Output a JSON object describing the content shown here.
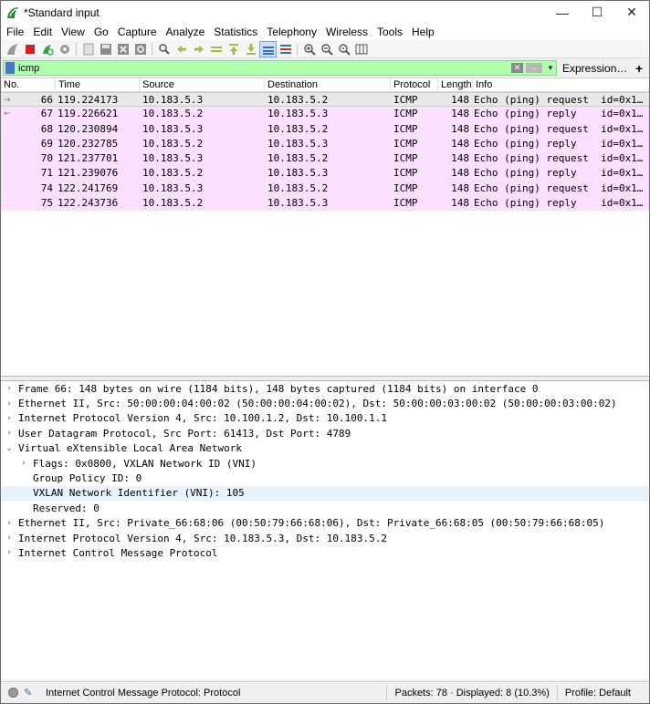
{
  "window": {
    "title": "*Standard input",
    "minimize_glyph": "—",
    "maximize_glyph": "☐",
    "close_glyph": "✕"
  },
  "menu": [
    "File",
    "Edit",
    "View",
    "Go",
    "Capture",
    "Analyze",
    "Statistics",
    "Telephony",
    "Wireless",
    "Tools",
    "Help"
  ],
  "toolbar_icons": [
    "shark-fin-icon",
    "stop-icon",
    "restart-icon",
    "capture-options-icon",
    "open-file-icon",
    "save-file-icon",
    "close-file-icon",
    "reload-icon",
    "find-packet-icon",
    "go-back-icon",
    "go-forward-icon",
    "go-to-packet-icon",
    "go-first-icon",
    "go-last-icon",
    "autoscroll-icon",
    "colorize-icon",
    "zoom-in-icon",
    "zoom-out-icon",
    "zoom-normal-icon",
    "resize-columns-icon"
  ],
  "filter": {
    "value": "icmp",
    "expression_label": "Expression…",
    "add_label": "+"
  },
  "packet_list": {
    "columns": [
      "No.",
      "Time",
      "Source",
      "Destination",
      "Protocol",
      "Length",
      "Info"
    ],
    "rows": [
      {
        "no": "66",
        "time": "119.224173",
        "src": "10.183.5.3",
        "dst": "10.183.5.2",
        "proto": "ICMP",
        "len": "148",
        "info": "Echo (ping) request  id=0x1…",
        "arrow": "→",
        "selected": true
      },
      {
        "no": "67",
        "time": "119.226621",
        "src": "10.183.5.2",
        "dst": "10.183.5.3",
        "proto": "ICMP",
        "len": "148",
        "info": "Echo (ping) reply    id=0x1…",
        "arrow": "←",
        "selected": false
      },
      {
        "no": "68",
        "time": "120.230894",
        "src": "10.183.5.3",
        "dst": "10.183.5.2",
        "proto": "ICMP",
        "len": "148",
        "info": "Echo (ping) request  id=0x1…",
        "arrow": "",
        "selected": false
      },
      {
        "no": "69",
        "time": "120.232785",
        "src": "10.183.5.2",
        "dst": "10.183.5.3",
        "proto": "ICMP",
        "len": "148",
        "info": "Echo (ping) reply    id=0x1…",
        "arrow": "",
        "selected": false
      },
      {
        "no": "70",
        "time": "121.237701",
        "src": "10.183.5.3",
        "dst": "10.183.5.2",
        "proto": "ICMP",
        "len": "148",
        "info": "Echo (ping) request  id=0x1…",
        "arrow": "",
        "selected": false
      },
      {
        "no": "71",
        "time": "121.239076",
        "src": "10.183.5.2",
        "dst": "10.183.5.3",
        "proto": "ICMP",
        "len": "148",
        "info": "Echo (ping) reply    id=0x1…",
        "arrow": "",
        "selected": false
      },
      {
        "no": "74",
        "time": "122.241769",
        "src": "10.183.5.3",
        "dst": "10.183.5.2",
        "proto": "ICMP",
        "len": "148",
        "info": "Echo (ping) request  id=0x1…",
        "arrow": "",
        "selected": false
      },
      {
        "no": "75",
        "time": "122.243736",
        "src": "10.183.5.2",
        "dst": "10.183.5.3",
        "proto": "ICMP",
        "len": "148",
        "info": "Echo (ping) reply    id=0x1…",
        "arrow": "",
        "selected": false
      }
    ]
  },
  "details": [
    {
      "text": "Frame 66: 148 bytes on wire (1184 bits), 148 bytes captured (1184 bits) on interface 0",
      "level": 0,
      "caret": "›",
      "highlight": false
    },
    {
      "text": "Ethernet II, Src: 50:00:00:04:00:02 (50:00:00:04:00:02), Dst: 50:00:00:03:00:02 (50:00:00:03:00:02)",
      "level": 0,
      "caret": "›",
      "highlight": false
    },
    {
      "text": "Internet Protocol Version 4, Src: 10.100.1.2, Dst: 10.100.1.1",
      "level": 0,
      "caret": "›",
      "highlight": false
    },
    {
      "text": "User Datagram Protocol, Src Port: 61413, Dst Port: 4789",
      "level": 0,
      "caret": "›",
      "highlight": false
    },
    {
      "text": "Virtual eXtensible Local Area Network",
      "level": 0,
      "caret": "⌄",
      "highlight": false
    },
    {
      "text": "Flags: 0x0800, VXLAN Network ID (VNI)",
      "level": 1,
      "caret": "›",
      "highlight": false
    },
    {
      "text": "Group Policy ID: 0",
      "level": 1,
      "caret": "",
      "highlight": false
    },
    {
      "text": "VXLAN Network Identifier (VNI): 105",
      "level": 1,
      "caret": "",
      "highlight": true
    },
    {
      "text": "Reserved: 0",
      "level": 1,
      "caret": "",
      "highlight": false
    },
    {
      "text": "Ethernet II, Src: Private_66:68:06 (00:50:79:66:68:06), Dst: Private_66:68:05 (00:50:79:66:68:05)",
      "level": 0,
      "caret": "›",
      "highlight": false
    },
    {
      "text": "Internet Protocol Version 4, Src: 10.183.5.3, Dst: 10.183.5.2",
      "level": 0,
      "caret": "›",
      "highlight": false
    },
    {
      "text": "Internet Control Message Protocol",
      "level": 0,
      "caret": "›",
      "highlight": false
    }
  ],
  "status": {
    "message": "Internet Control Message Protocol: Protocol",
    "packets": "Packets: 78 · Displayed: 8 (10.3%)",
    "profile": "Profile: Default"
  },
  "colors": {
    "filter_ok": "#afffaf",
    "icmp_row": "#fce0ff",
    "selected_row": "#e8e8e8",
    "detail_highlight": "#e9f1fb"
  }
}
